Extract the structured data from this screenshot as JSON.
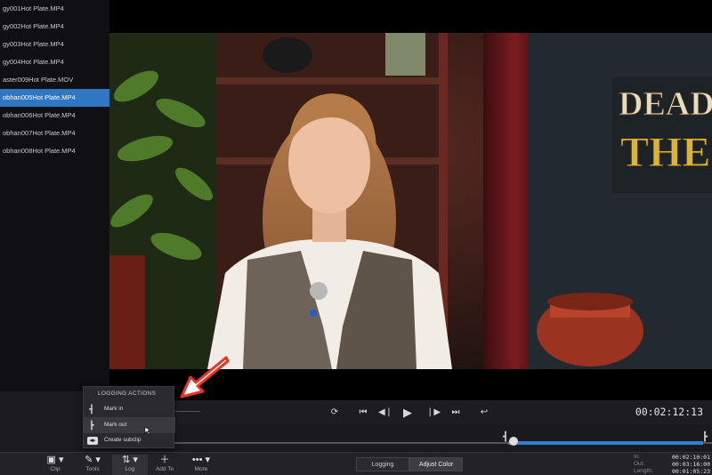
{
  "clips": [
    {
      "label": "gy001Hot Plate.MP4",
      "selected": false
    },
    {
      "label": "gy002Hot Plate.MP4",
      "selected": false
    },
    {
      "label": "gy003Hot Plate.MP4",
      "selected": false
    },
    {
      "label": "gy004Hot Plate.MP4",
      "selected": false
    },
    {
      "label": "aster009Hot Plate.MOV",
      "selected": false
    },
    {
      "label": "obhan005Hot Plate.MP4",
      "selected": true
    },
    {
      "label": "obhan006Hot Plate.MP4",
      "selected": false
    },
    {
      "label": "obhan007Hot Plate.MP4",
      "selected": false
    },
    {
      "label": "obhan008Hot Plate.MP4",
      "selected": false
    }
  ],
  "video": {
    "sign_text_line1": "DEAD",
    "sign_text_line2": "THE"
  },
  "transport": {
    "timecode": "00:02:12:13"
  },
  "scrubber": {
    "playhead_fraction": 0.0,
    "range_start_fraction": 0.0,
    "range_end_fraction": 1.0
  },
  "logging_actions": {
    "title": "LOGGING ACTIONS",
    "items": [
      {
        "label": "Mark in",
        "icon": "mark-in-icon"
      },
      {
        "label": "Mark out",
        "icon": "mark-out-icon"
      },
      {
        "label": "Create subclip",
        "icon": "subclip-icon"
      }
    ]
  },
  "toolbar": {
    "tools": [
      {
        "label": "Clip",
        "icon": "clip-icon"
      },
      {
        "label": "Tools",
        "icon": "wrench-icon"
      },
      {
        "label": "Log",
        "icon": "log-icon"
      },
      {
        "label": "Add To",
        "icon": "plus-icon"
      },
      {
        "label": "More",
        "icon": "more-icon"
      }
    ],
    "tabs": {
      "logging": "Logging",
      "adjust_color": "Adjust Color"
    },
    "timecodes": [
      {
        "key": "In:",
        "value": "00:02:10:01"
      },
      {
        "key": "Out:",
        "value": "00:03:16:00"
      },
      {
        "key": "Length:",
        "value": "00:01:05:23"
      }
    ]
  },
  "colors": {
    "selection": "#2f77c2",
    "range": "#2f7fd6",
    "annotation_arrow": "#e8322a"
  }
}
